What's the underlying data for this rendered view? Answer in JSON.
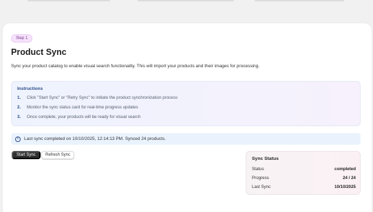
{
  "step_badge": "Step 1",
  "page_title": "Product Sync",
  "description": "Sync your product catalog to enable visual search functionality. This will import your products and their images for processing.",
  "instructions": {
    "title": "Instructions",
    "items": [
      {
        "num": "1.",
        "text": "Click \"Start Sync\" or \"Retry Sync\" to initiate the product synchronization process"
      },
      {
        "num": "2.",
        "text": "Monitor the sync status card for real-time progress updates"
      },
      {
        "num": "3.",
        "text": "Once complete, your products will be ready for visual search"
      }
    ]
  },
  "banner": {
    "icon": "info-icon",
    "text": "Last sync completed on 10/10/2025, 12:14:13 PM. Synced 24 products."
  },
  "buttons": {
    "start_sync": "Start Sync",
    "refresh_sync": "Refresh Sync"
  },
  "sync_status": {
    "title": "Sync Status",
    "rows": [
      {
        "label": "Status",
        "value": "completed"
      },
      {
        "label": "Progress",
        "value": "24 / 24"
      },
      {
        "label": "Last Sync",
        "value": "10/10/2025"
      }
    ]
  },
  "colors": {
    "primary_button": "#303030",
    "badge_bg": "#f5e3fb",
    "instructions_accent": "#2c4a8a",
    "banner_bg": "#eaf3fd"
  }
}
